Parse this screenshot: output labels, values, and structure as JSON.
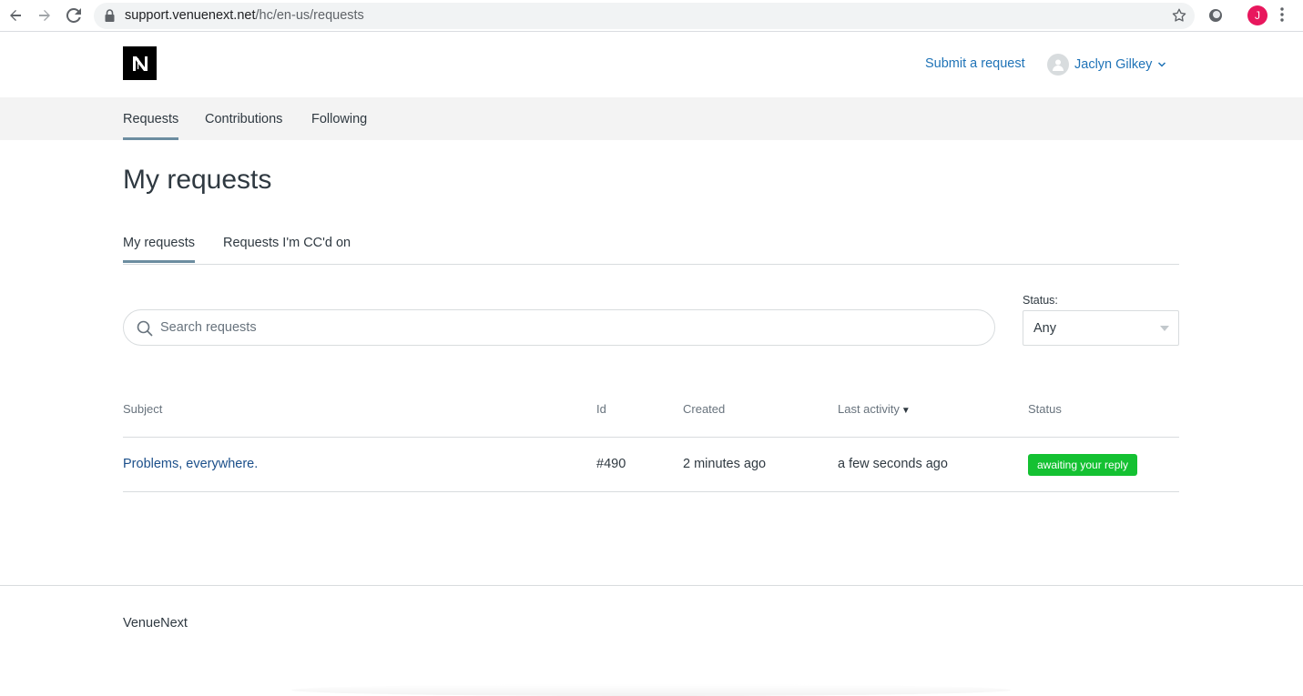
{
  "browser": {
    "url_host": "support.venuenext.net",
    "url_path": "/hc/en-us/requests",
    "profile_initial": "J"
  },
  "header": {
    "submit_label": "Submit a request",
    "user_name": "Jaclyn Gilkey"
  },
  "subnav": {
    "items": [
      {
        "label": "Requests",
        "active": true
      },
      {
        "label": "Contributions",
        "active": false
      },
      {
        "label": "Following",
        "active": false
      }
    ]
  },
  "page": {
    "title": "My requests",
    "tabs": [
      {
        "label": "My requests",
        "active": true
      },
      {
        "label": "Requests I'm CC'd on",
        "active": false
      }
    ]
  },
  "filters": {
    "search_placeholder": "Search requests",
    "status_label": "Status:",
    "status_value": "Any"
  },
  "table": {
    "headers": {
      "subject": "Subject",
      "id": "Id",
      "created": "Created",
      "last_activity": "Last activity",
      "status": "Status"
    },
    "rows": [
      {
        "subject": "Problems, everywhere.",
        "id": "#490",
        "created": "2 minutes ago",
        "last_activity": "a few seconds ago",
        "status": "awaiting your reply"
      }
    ]
  },
  "footer": {
    "brand": "VenueNext"
  },
  "colors": {
    "link": "#1f73b7",
    "active_underline": "#6c8da0",
    "status_badge": "#14c132",
    "profile": "#e8175d"
  }
}
